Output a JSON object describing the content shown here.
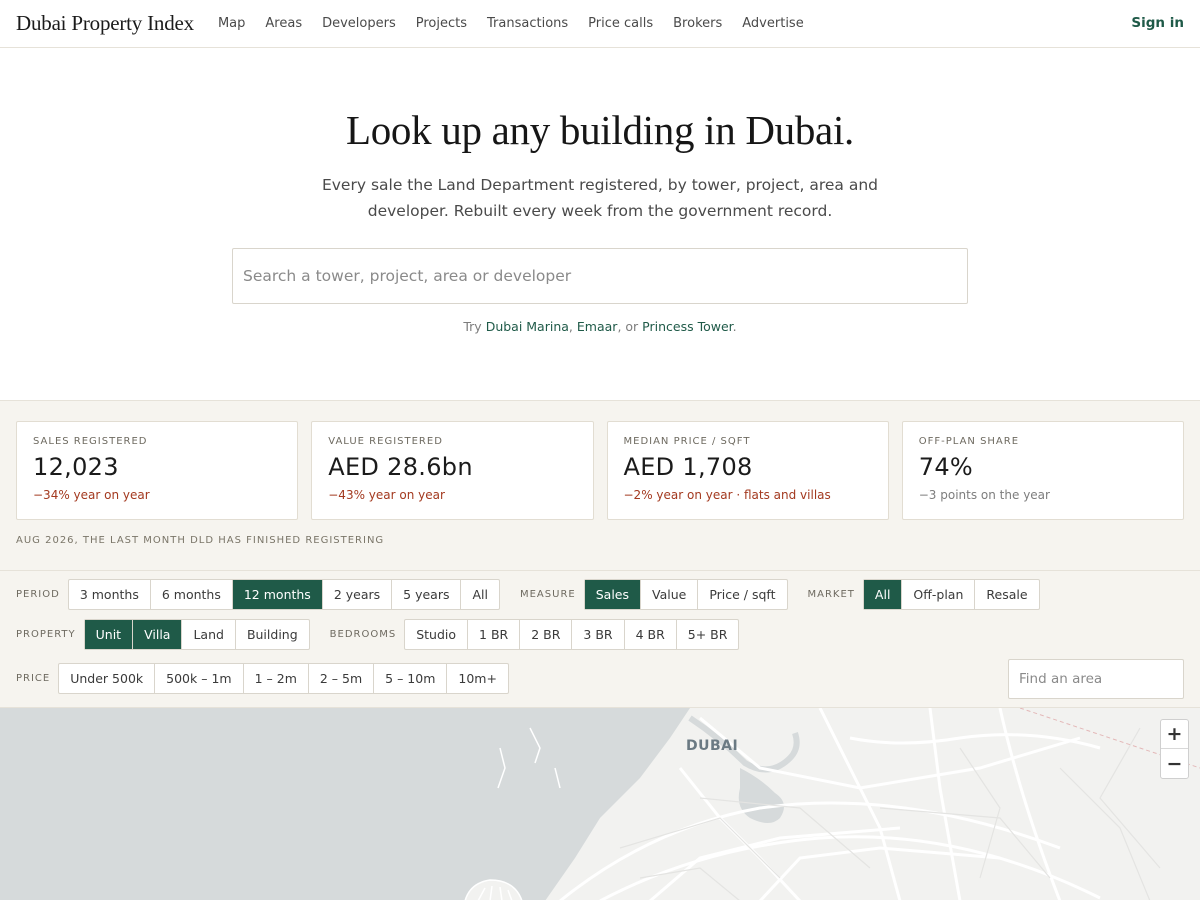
{
  "header": {
    "brand": "Dubai Property Index",
    "nav": [
      "Map",
      "Areas",
      "Developers",
      "Projects",
      "Transactions",
      "Price calls",
      "Brokers",
      "Advertise"
    ],
    "signin": "Sign in"
  },
  "hero": {
    "title": "Look up any building in Dubai.",
    "subtitle": "Every sale the Land Department registered, by tower, project, area and developer. Rebuilt every week from the government record.",
    "search_placeholder": "Search a tower, project, area or developer",
    "try_prefix": "Try",
    "try_links": [
      "Dubai Marina",
      "Emaar",
      "Princess Tower"
    ],
    "try_sep1": ",",
    "try_sep2": ", or",
    "try_end": "."
  },
  "stats": [
    {
      "label": "SALES REGISTERED",
      "value": "12,023",
      "change": "−34% year on year",
      "tone": "neg"
    },
    {
      "label": "VALUE REGISTERED",
      "value": "AED 28.6bn",
      "change": "−43% year on year",
      "tone": "neg"
    },
    {
      "label": "MEDIAN PRICE / SQFT",
      "value": "AED 1,708",
      "change": "−2% year on year · flats and villas",
      "tone": "neg"
    },
    {
      "label": "OFF-PLAN SHARE",
      "value": "74%",
      "change": "−3 points on the year",
      "tone": "neu"
    }
  ],
  "stats_note": "AUG 2026, THE LAST MONTH DLD HAS FINISHED REGISTERING",
  "filters": {
    "period": {
      "label": "PERIOD",
      "options": [
        "3 months",
        "6 months",
        "12 months",
        "2 years",
        "5 years",
        "All"
      ],
      "selected": [
        "12 months"
      ]
    },
    "measure": {
      "label": "MEASURE",
      "options": [
        "Sales",
        "Value",
        "Price / sqft"
      ],
      "selected": [
        "Sales"
      ]
    },
    "market": {
      "label": "MARKET",
      "options": [
        "All",
        "Off-plan",
        "Resale"
      ],
      "selected": [
        "All"
      ]
    },
    "property": {
      "label": "PROPERTY",
      "options": [
        "Unit",
        "Villa",
        "Land",
        "Building"
      ],
      "selected": [
        "Unit",
        "Villa"
      ]
    },
    "bedrooms": {
      "label": "BEDROOMS",
      "options": [
        "Studio",
        "1 BR",
        "2 BR",
        "3 BR",
        "4 BR",
        "5+ BR"
      ],
      "selected": []
    },
    "price": {
      "label": "PRICE",
      "options": [
        "Under 500k",
        "500k – 1m",
        "1 – 2m",
        "2 – 5m",
        "5 – 10m",
        "10m+"
      ],
      "selected": []
    },
    "find_area_placeholder": "Find an area"
  },
  "map": {
    "city_label": "DUBAI",
    "zoom_in": "+",
    "zoom_out": "−",
    "water_color": "#d6dadb",
    "land_color": "#f2f2f0"
  },
  "colors": {
    "accent": "#1f5a48",
    "negative": "#a3391f",
    "panel_bg": "#f6f4ef"
  }
}
